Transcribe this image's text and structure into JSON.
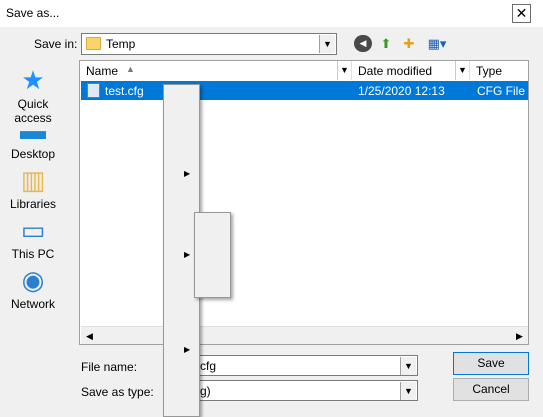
{
  "dialog": {
    "title": "Save as...",
    "close_glyph": "✕"
  },
  "toolbar": {
    "save_in_label": "Save in:",
    "save_in_value": "Temp",
    "dropdown_glyph": "▼",
    "back_glyph": "◀",
    "up_glyph": "⬆",
    "new_folder_glyph": "✚",
    "views_glyph": "▦▾"
  },
  "places": [
    {
      "label": "Quick access",
      "icon": "star-icon",
      "glyph": "★"
    },
    {
      "label": "Desktop",
      "icon": "desktop-icon",
      "glyph": "▬"
    },
    {
      "label": "Libraries",
      "icon": "libraries-icon",
      "glyph": "▥"
    },
    {
      "label": "This PC",
      "icon": "computer-icon",
      "glyph": "▭"
    },
    {
      "label": "Network",
      "icon": "network-icon",
      "glyph": "◉"
    }
  ],
  "file_list": {
    "columns": [
      "Name",
      "Date modified",
      "Type"
    ],
    "sort_glyph": "▲",
    "col_dropdown_glyph": "▼",
    "rows": [
      {
        "name": "test.cfg",
        "date": "1/25/2020 12:13",
        "type": "CFG File",
        "selected": true
      }
    ],
    "scroll_left_glyph": "◀",
    "scroll_right_glyph": "▶"
  },
  "context_menus": {
    "submenu_glyph": "▶"
  },
  "footer": {
    "file_name_label": "File name:",
    "file_name_value": "cfg",
    "save_as_type_label": "Save as type:",
    "save_as_type_value": "g)",
    "save_label": "Save",
    "cancel_label": "Cancel"
  },
  "colors": {
    "selection": "#0078d7",
    "folder": "#f8d46b",
    "quick_access": "#1e90ff",
    "desktop": "#1a86d6"
  }
}
